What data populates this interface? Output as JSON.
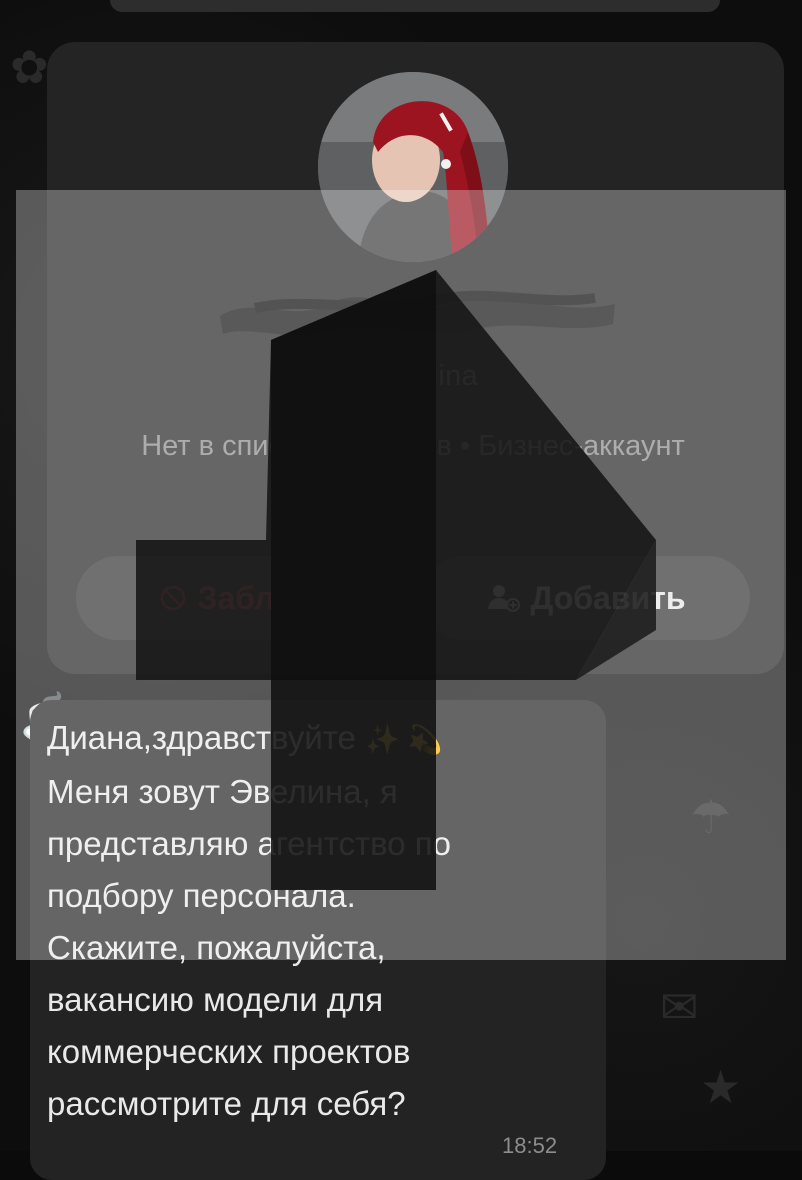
{
  "contact": {
    "username": "~Hr Evelina",
    "status_text": "Нет в списке контактов • Бизнес-аккаунт"
  },
  "actions": {
    "block_label": "Заблок.",
    "add_label": "Добавить"
  },
  "message": {
    "lines": [
      "Диана,здравствуйте",
      "Меня зовут Эвелина, я",
      "представляю агентство по",
      "подбору персонала.",
      "Скажите, пожалуйста,",
      "вакансию модели для",
      "коммерческих проектов",
      "рассмотрите для себя?"
    ],
    "emoji": "✨ 💫",
    "time": "18:52"
  },
  "colors": {
    "block_red": "#e84a5f",
    "card_bg": "#242424",
    "bubble_bg": "#232323"
  },
  "icons": {
    "block": "no-entry-icon",
    "add": "add-contact-icon"
  }
}
